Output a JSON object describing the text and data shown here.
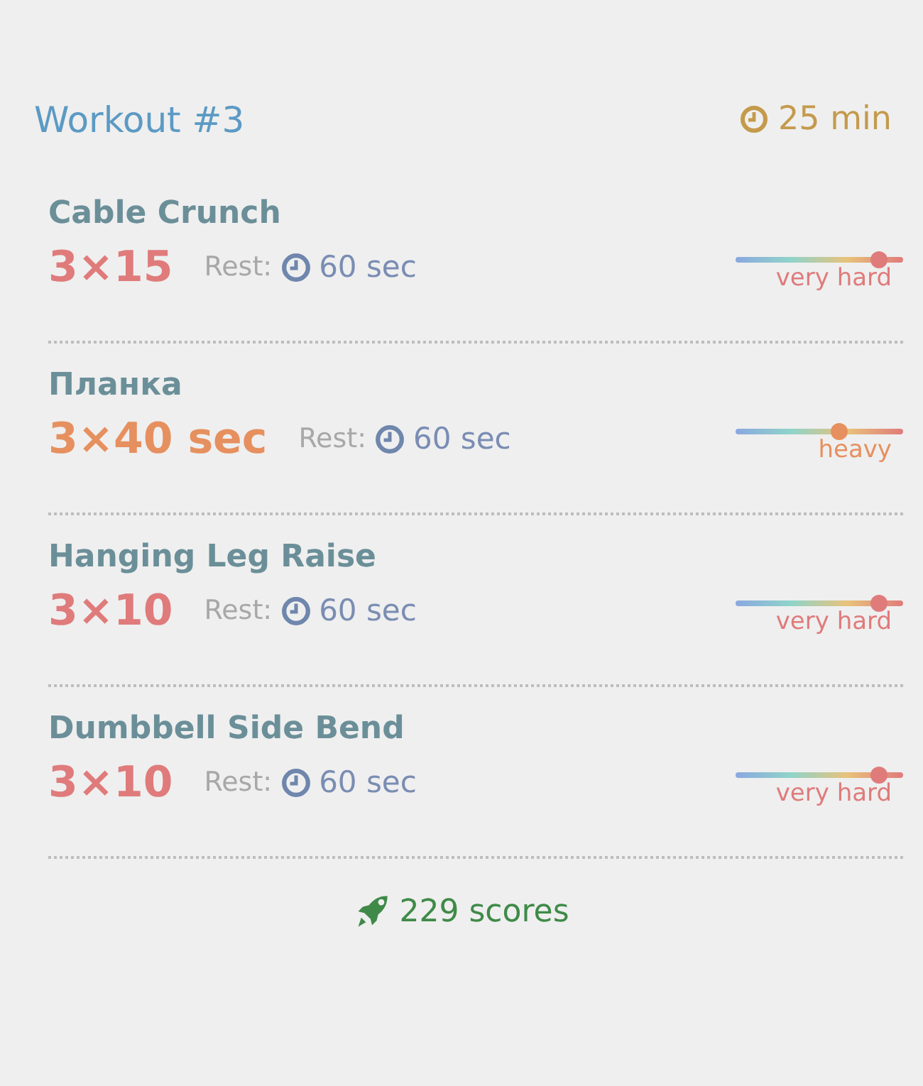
{
  "header": {
    "title": "Workout #3",
    "duration": "25 min"
  },
  "exercises": [
    {
      "name": "Cable Crunch",
      "sets": "3×15",
      "rest_label": "Rest:",
      "rest": "60 sec",
      "level": 0.86,
      "intensity": "very hard",
      "color": "#e07b7b"
    },
    {
      "name": "Планка",
      "sets": "3×40 sec",
      "rest_label": "Rest:",
      "rest": "60 sec",
      "level": 0.62,
      "intensity": "heavy",
      "color": "#e6905f"
    },
    {
      "name": "Hanging Leg Raise",
      "sets": "3×10",
      "rest_label": "Rest:",
      "rest": "60 sec",
      "level": 0.86,
      "intensity": "very hard",
      "color": "#e07b7b"
    },
    {
      "name": "Dumbbell Side Bend",
      "sets": "3×10",
      "rest_label": "Rest:",
      "rest": "60 sec",
      "level": 0.86,
      "intensity": "very hard",
      "color": "#e07b7b"
    }
  ],
  "footer": {
    "scores": "229 scores"
  }
}
